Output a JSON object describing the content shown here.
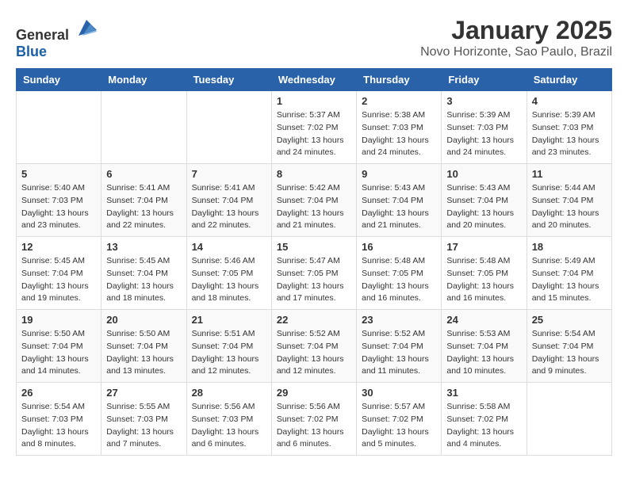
{
  "header": {
    "logo_general": "General",
    "logo_blue": "Blue",
    "month_year": "January 2025",
    "location": "Novo Horizonte, Sao Paulo, Brazil"
  },
  "weekdays": [
    "Sunday",
    "Monday",
    "Tuesday",
    "Wednesday",
    "Thursday",
    "Friday",
    "Saturday"
  ],
  "weeks": [
    [
      {
        "day": null,
        "sunrise": null,
        "sunset": null,
        "daylight": null
      },
      {
        "day": null,
        "sunrise": null,
        "sunset": null,
        "daylight": null
      },
      {
        "day": null,
        "sunrise": null,
        "sunset": null,
        "daylight": null
      },
      {
        "day": "1",
        "sunrise": "5:37 AM",
        "sunset": "7:02 PM",
        "daylight": "13 hours and 24 minutes."
      },
      {
        "day": "2",
        "sunrise": "5:38 AM",
        "sunset": "7:03 PM",
        "daylight": "13 hours and 24 minutes."
      },
      {
        "day": "3",
        "sunrise": "5:39 AM",
        "sunset": "7:03 PM",
        "daylight": "13 hours and 24 minutes."
      },
      {
        "day": "4",
        "sunrise": "5:39 AM",
        "sunset": "7:03 PM",
        "daylight": "13 hours and 23 minutes."
      }
    ],
    [
      {
        "day": "5",
        "sunrise": "5:40 AM",
        "sunset": "7:03 PM",
        "daylight": "13 hours and 23 minutes."
      },
      {
        "day": "6",
        "sunrise": "5:41 AM",
        "sunset": "7:04 PM",
        "daylight": "13 hours and 22 minutes."
      },
      {
        "day": "7",
        "sunrise": "5:41 AM",
        "sunset": "7:04 PM",
        "daylight": "13 hours and 22 minutes."
      },
      {
        "day": "8",
        "sunrise": "5:42 AM",
        "sunset": "7:04 PM",
        "daylight": "13 hours and 21 minutes."
      },
      {
        "day": "9",
        "sunrise": "5:43 AM",
        "sunset": "7:04 PM",
        "daylight": "13 hours and 21 minutes."
      },
      {
        "day": "10",
        "sunrise": "5:43 AM",
        "sunset": "7:04 PM",
        "daylight": "13 hours and 20 minutes."
      },
      {
        "day": "11",
        "sunrise": "5:44 AM",
        "sunset": "7:04 PM",
        "daylight": "13 hours and 20 minutes."
      }
    ],
    [
      {
        "day": "12",
        "sunrise": "5:45 AM",
        "sunset": "7:04 PM",
        "daylight": "13 hours and 19 minutes."
      },
      {
        "day": "13",
        "sunrise": "5:45 AM",
        "sunset": "7:04 PM",
        "daylight": "13 hours and 18 minutes."
      },
      {
        "day": "14",
        "sunrise": "5:46 AM",
        "sunset": "7:05 PM",
        "daylight": "13 hours and 18 minutes."
      },
      {
        "day": "15",
        "sunrise": "5:47 AM",
        "sunset": "7:05 PM",
        "daylight": "13 hours and 17 minutes."
      },
      {
        "day": "16",
        "sunrise": "5:48 AM",
        "sunset": "7:05 PM",
        "daylight": "13 hours and 16 minutes."
      },
      {
        "day": "17",
        "sunrise": "5:48 AM",
        "sunset": "7:05 PM",
        "daylight": "13 hours and 16 minutes."
      },
      {
        "day": "18",
        "sunrise": "5:49 AM",
        "sunset": "7:04 PM",
        "daylight": "13 hours and 15 minutes."
      }
    ],
    [
      {
        "day": "19",
        "sunrise": "5:50 AM",
        "sunset": "7:04 PM",
        "daylight": "13 hours and 14 minutes."
      },
      {
        "day": "20",
        "sunrise": "5:50 AM",
        "sunset": "7:04 PM",
        "daylight": "13 hours and 13 minutes."
      },
      {
        "day": "21",
        "sunrise": "5:51 AM",
        "sunset": "7:04 PM",
        "daylight": "13 hours and 12 minutes."
      },
      {
        "day": "22",
        "sunrise": "5:52 AM",
        "sunset": "7:04 PM",
        "daylight": "13 hours and 12 minutes."
      },
      {
        "day": "23",
        "sunrise": "5:52 AM",
        "sunset": "7:04 PM",
        "daylight": "13 hours and 11 minutes."
      },
      {
        "day": "24",
        "sunrise": "5:53 AM",
        "sunset": "7:04 PM",
        "daylight": "13 hours and 10 minutes."
      },
      {
        "day": "25",
        "sunrise": "5:54 AM",
        "sunset": "7:04 PM",
        "daylight": "13 hours and 9 minutes."
      }
    ],
    [
      {
        "day": "26",
        "sunrise": "5:54 AM",
        "sunset": "7:03 PM",
        "daylight": "13 hours and 8 minutes."
      },
      {
        "day": "27",
        "sunrise": "5:55 AM",
        "sunset": "7:03 PM",
        "daylight": "13 hours and 7 minutes."
      },
      {
        "day": "28",
        "sunrise": "5:56 AM",
        "sunset": "7:03 PM",
        "daylight": "13 hours and 6 minutes."
      },
      {
        "day": "29",
        "sunrise": "5:56 AM",
        "sunset": "7:02 PM",
        "daylight": "13 hours and 6 minutes."
      },
      {
        "day": "30",
        "sunrise": "5:57 AM",
        "sunset": "7:02 PM",
        "daylight": "13 hours and 5 minutes."
      },
      {
        "day": "31",
        "sunrise": "5:58 AM",
        "sunset": "7:02 PM",
        "daylight": "13 hours and 4 minutes."
      },
      {
        "day": null,
        "sunrise": null,
        "sunset": null,
        "daylight": null
      }
    ]
  ]
}
